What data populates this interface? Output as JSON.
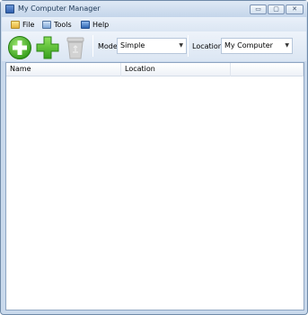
{
  "window": {
    "title": "My Computer Manager"
  },
  "title_buttons": {
    "minimize": "▭",
    "maximize": "▢",
    "close": "✕"
  },
  "menu": {
    "items": [
      {
        "label": "File",
        "icon": "file-icon"
      },
      {
        "label": "Tools",
        "icon": "tools-icon"
      },
      {
        "label": "Help",
        "icon": "help-icon"
      }
    ]
  },
  "toolbar": {
    "buttons": [
      {
        "icon": "add-circle-icon",
        "enabled": true
      },
      {
        "icon": "add-plus-icon",
        "enabled": true
      },
      {
        "icon": "recycle-bin-icon",
        "enabled": false
      }
    ],
    "mode_label": "Mode",
    "mode_value": "Simple",
    "location_label": "Location",
    "location_value": "My Computer"
  },
  "list": {
    "columns": [
      "Name",
      "Location",
      ""
    ],
    "rows": []
  },
  "colors": {
    "accent_green": "#3faa1f",
    "window_frame": "#c9d9ec"
  }
}
